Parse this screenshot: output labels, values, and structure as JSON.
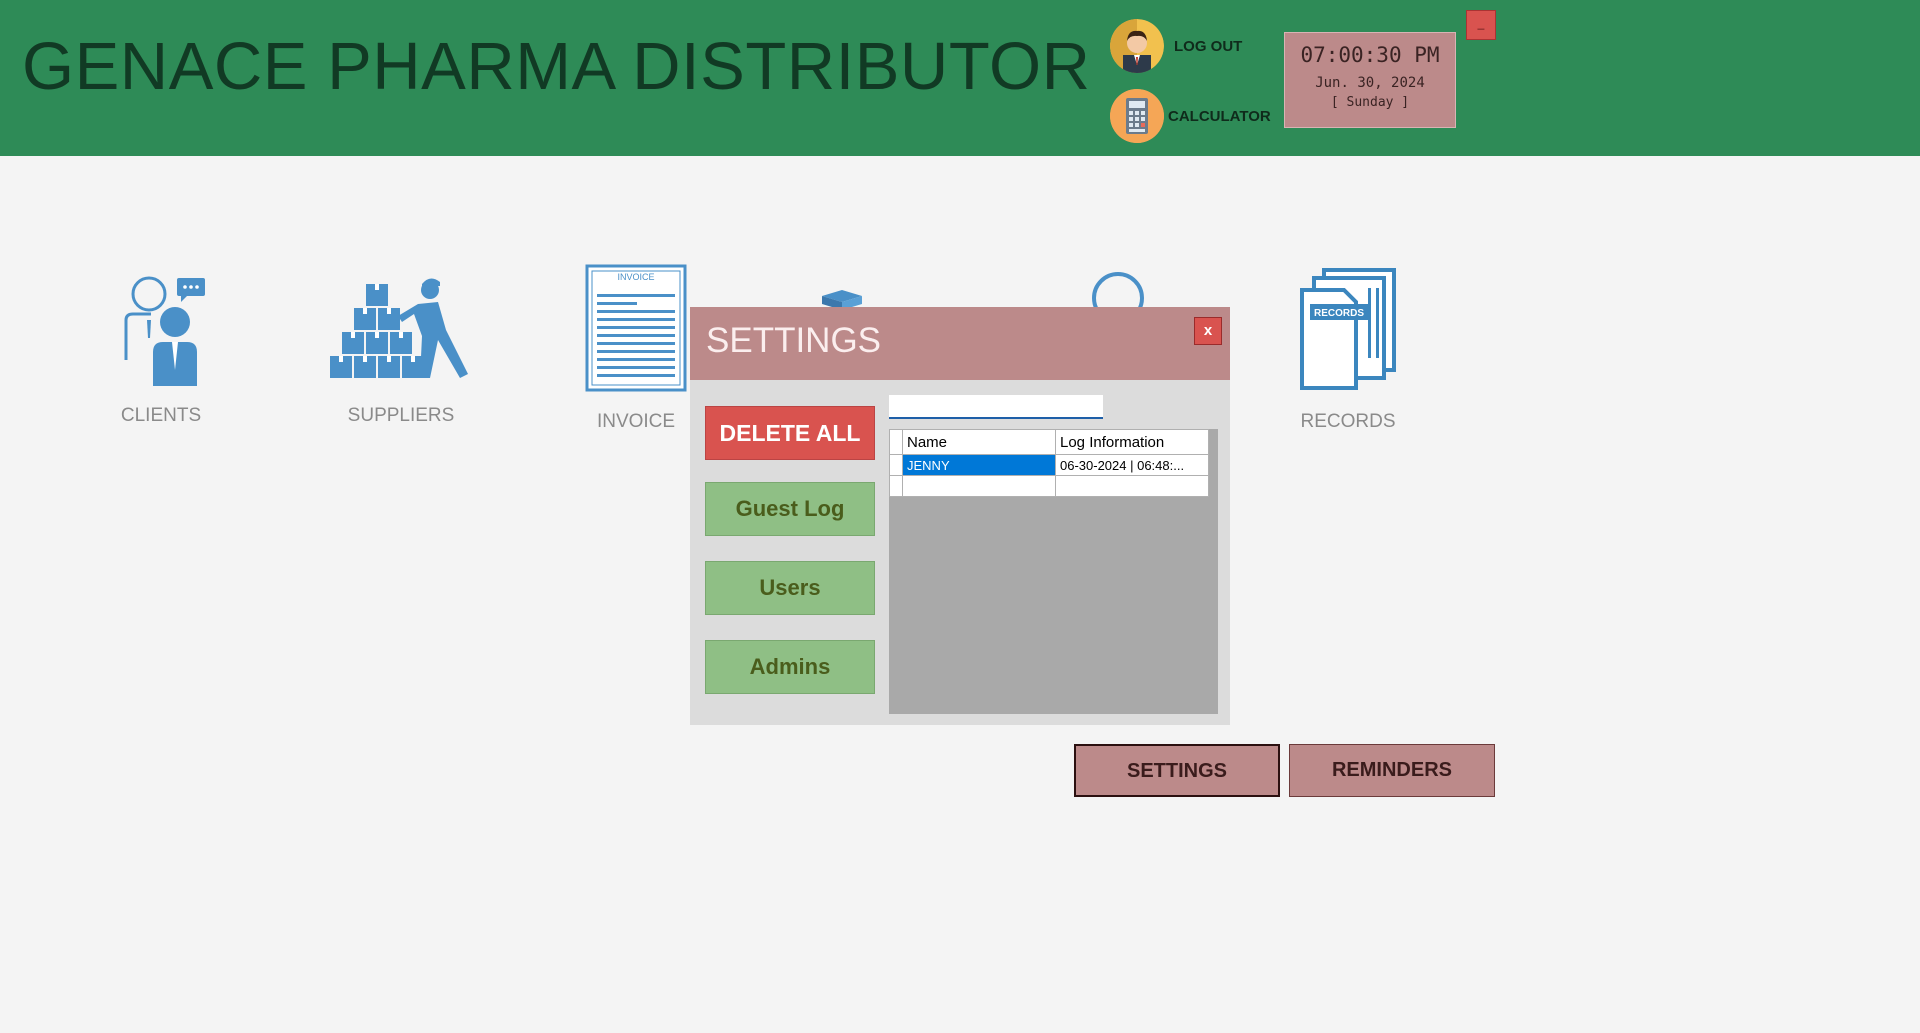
{
  "app": {
    "title": "GENACE PHARMA DISTRIBUTOR"
  },
  "header": {
    "logout_label": "LOG OUT",
    "calculator_label": "CALCULATOR",
    "minimize_label": "_"
  },
  "clock": {
    "time": "07:00:30 PM",
    "date": "Jun. 30, 2024",
    "day": "[ Sunday ]"
  },
  "modules": [
    {
      "label": "CLIENTS",
      "icon": "clients-icon"
    },
    {
      "label": "SUPPLIERS",
      "icon": "suppliers-icon"
    },
    {
      "label": "INVOICE",
      "icon": "invoice-icon"
    },
    {
      "label": "RECORDS",
      "icon": "records-icon"
    }
  ],
  "icon_text": {
    "invoice": "INVOICE",
    "records": "RECORDS"
  },
  "bottom": {
    "settings_label": "SETTINGS",
    "reminders_label": "REMINDERS"
  },
  "dialog": {
    "title": "SETTINGS",
    "close_label": "x",
    "delete_all_label": "DELETE ALL",
    "guest_log_label": "Guest Log",
    "users_label": "Users",
    "admins_label": "Admins",
    "search_value": "",
    "grid": {
      "columns": [
        "Name",
        "Log Information"
      ],
      "rows": [
        {
          "name": "JENNY",
          "log": "06-30-2024 | 06:48:..."
        }
      ]
    }
  },
  "colors": {
    "header_bg": "#2e8b57",
    "accent_rose": "#bc8a8a",
    "danger_red": "#d9534f",
    "green_button": "#8fbf85",
    "icon_blue": "#4a90c8",
    "selection_blue": "#0078d7"
  }
}
